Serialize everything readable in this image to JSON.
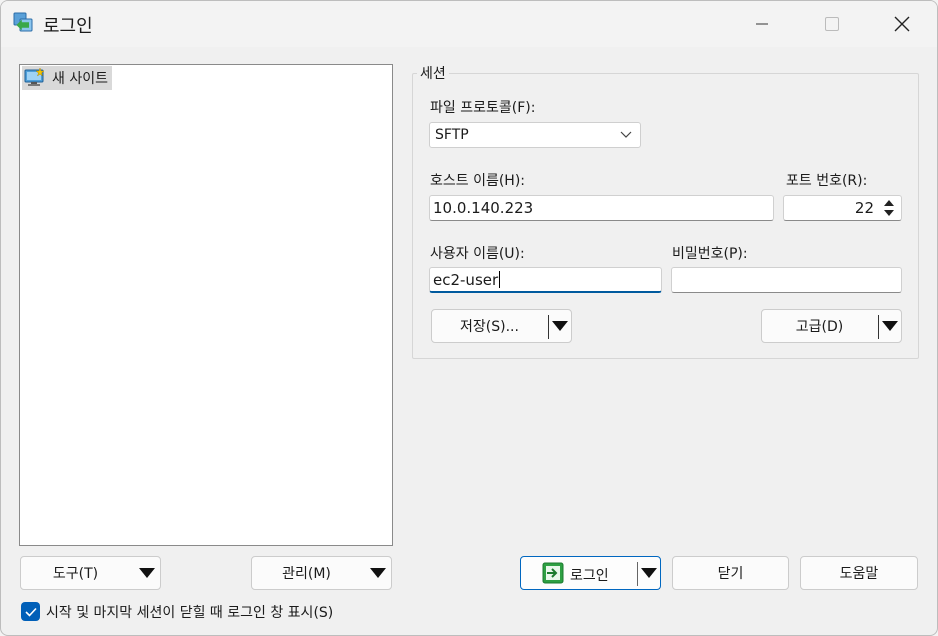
{
  "window": {
    "title": "로그인",
    "icon": "winscp-login-icon"
  },
  "sites": {
    "items": [
      {
        "label": "새 사이트",
        "icon": "new-site-monitor-icon"
      }
    ]
  },
  "session": {
    "group_title": "세션",
    "protocol_label": "파일 프로토콜(F):",
    "protocol_value": "SFTP",
    "host_label": "호스트 이름(H):",
    "host_value": "10.0.140.223",
    "port_label": "포트 번호(R):",
    "port_value": "22",
    "user_label": "사용자 이름(U):",
    "user_value": "ec2-user",
    "password_label": "비밀번호(P):",
    "password_value": "",
    "save_button": "저장(S)...",
    "advanced_button": "고급(D)"
  },
  "footer": {
    "tools_button": "도구(T)",
    "manage_button": "관리(M)",
    "login_button": "로그인",
    "close_button": "닫기",
    "help_button": "도움말",
    "checkbox_label": "시작 및 마지막 세션이 닫힐 때 로그인 창 표시(S)",
    "checkbox_checked": true
  },
  "colors": {
    "accent": "#005fb8",
    "window_bg": "#f0f0f0",
    "panel_bg": "#ffffff"
  }
}
